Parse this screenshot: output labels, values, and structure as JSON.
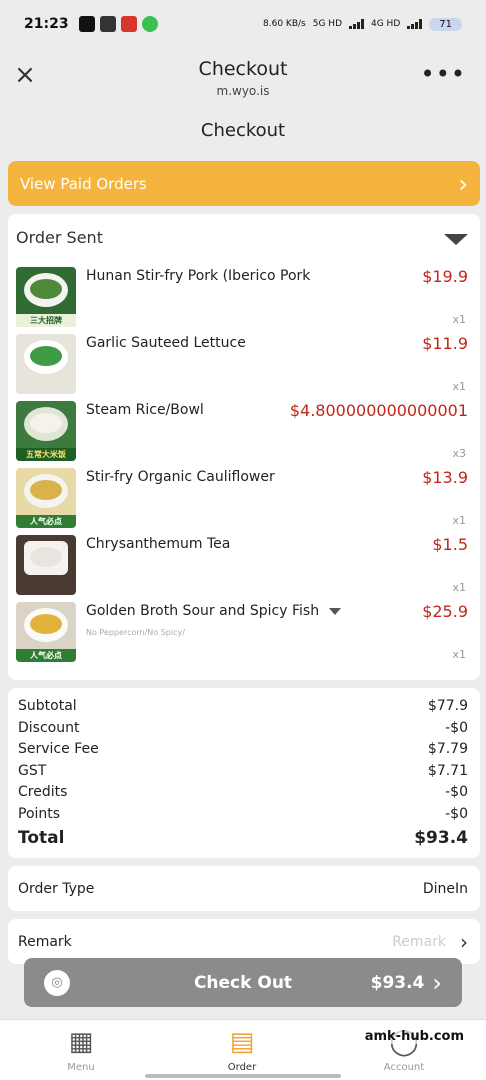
{
  "status_bar": {
    "time": "21:23",
    "network": "8.60 KB/s",
    "sim1": "5G HD",
    "sim2": "4G HD",
    "battery": "71"
  },
  "header": {
    "title": "Checkout",
    "url": "m.wyo.is"
  },
  "page_title": "Checkout",
  "paid_orders_label": "View Paid Orders",
  "order_section": {
    "title": "Order Sent",
    "items": [
      {
        "name": "Hunan Stir-fry Pork (Iberico Pork",
        "price": "$19.9",
        "qty": "x1",
        "note": "",
        "badge": "三大招牌",
        "food_color": "#4f8a3a",
        "band_color": "#2e7d32"
      },
      {
        "name": "Garlic Sauteed Lettuce",
        "price": "$11.9",
        "qty": "x1",
        "note": "",
        "badge": "",
        "food_color": "#3f9b45",
        "band_color": ""
      },
      {
        "name": "Steam Rice/Bowl",
        "price": "$4.800000000000001",
        "qty": "x3",
        "note": "",
        "badge": "五常大米饭",
        "food_color": "#f5f2ea",
        "band_color": "#2e7d32"
      },
      {
        "name": "Stir-fry Organic Cauliflower",
        "price": "$13.9",
        "qty": "x1",
        "note": "",
        "badge": "人气必点",
        "food_color": "#d9b24a",
        "band_color": "#2e7d32"
      },
      {
        "name": "Chrysanthemum Tea",
        "price": "$1.5",
        "qty": "x1",
        "note": "",
        "badge": "",
        "food_color": "#e8e4de",
        "band_color": ""
      },
      {
        "name": "Golden Broth Sour and Spicy Fish",
        "price": "$25.9",
        "qty": "x1",
        "note": "No Peppercorn/No Spicy/",
        "badge": "人气必点",
        "food_color": "#e2b23b",
        "band_color": "#2e7d32"
      }
    ]
  },
  "summary": {
    "subtotal_label": "Subtotal",
    "subtotal": "$77.9",
    "discount_label": "Discount",
    "discount": "-$0",
    "service_fee_label": "Service Fee",
    "service_fee": "$7.79",
    "gst_label": "GST",
    "gst": "$7.71",
    "credits_label": "Credits",
    "credits": "-$0",
    "points_label": "Points",
    "points": "-$0",
    "total_label": "Total",
    "total": "$93.4"
  },
  "order_type": {
    "label": "Order Type",
    "value": "DineIn"
  },
  "remark": {
    "label": "Remark",
    "placeholder": "Remark"
  },
  "checkout": {
    "label": "Check Out",
    "amount": "$93.4"
  },
  "tabbar": {
    "menu": "Menu",
    "order": "Order",
    "account": "Account"
  },
  "watermark": "amk-hub.com",
  "colors": {
    "accent": "#f4b43e",
    "price": "#c0271b",
    "checkout_bg": "#8b8b8b"
  }
}
